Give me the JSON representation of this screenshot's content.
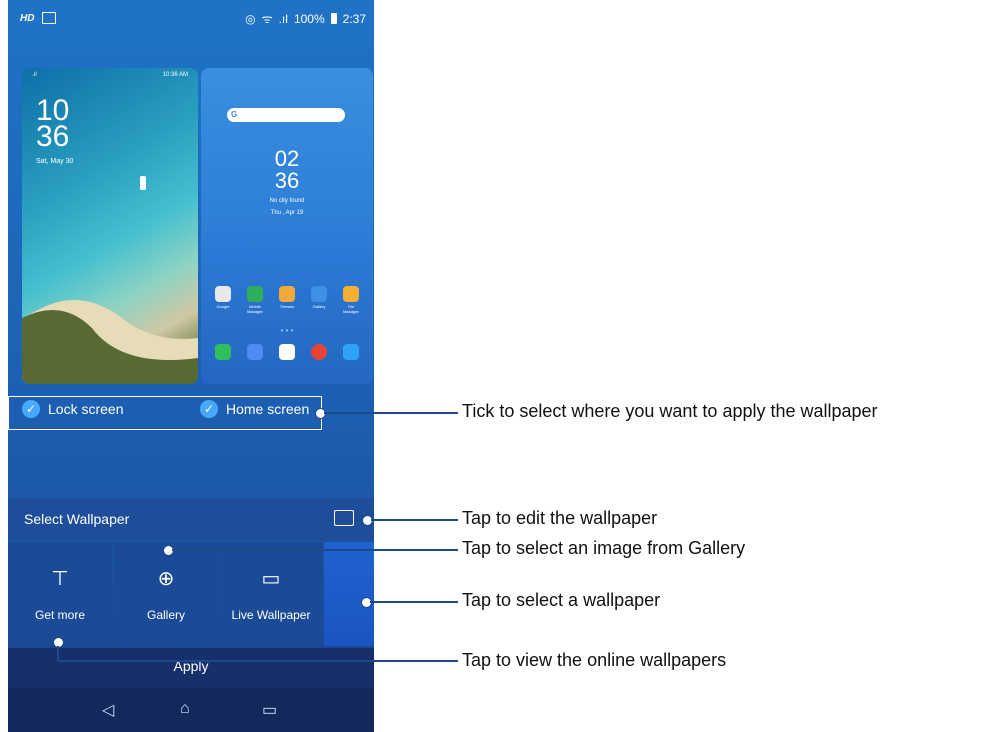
{
  "status_bar": {
    "hd": "HD",
    "battery_percent": "100%",
    "time": "2:37"
  },
  "lock_preview": {
    "hour": "10",
    "minute": "36",
    "date": "Sat, May 30",
    "mini_time": "10:36 AM"
  },
  "home_preview": {
    "hour": "02",
    "minute": "36",
    "weather": "No city found",
    "date": "Thu , Apr 19",
    "apps": [
      "Google",
      "Mobile Manager",
      "Themes",
      "Gallery",
      "File Manager"
    ]
  },
  "targets": [
    {
      "label": "Lock screen",
      "checked": true
    },
    {
      "label": "Home screen",
      "checked": true
    }
  ],
  "select_bar": {
    "label": "Select Wallpaper"
  },
  "tiles": [
    {
      "label": "Get more",
      "icon": "paint-roller-icon"
    },
    {
      "label": "Gallery",
      "icon": "balloon-icon"
    },
    {
      "label": "Live Wallpaper",
      "icon": "live-image-icon"
    }
  ],
  "apply_label": "Apply",
  "callouts": [
    "Tick to select where you want to apply the wallpaper",
    "Tap to edit the wallpaper",
    "Tap to select an image from Gallery",
    "Tap to select a wallpaper",
    "Tap to view the online wallpapers"
  ]
}
